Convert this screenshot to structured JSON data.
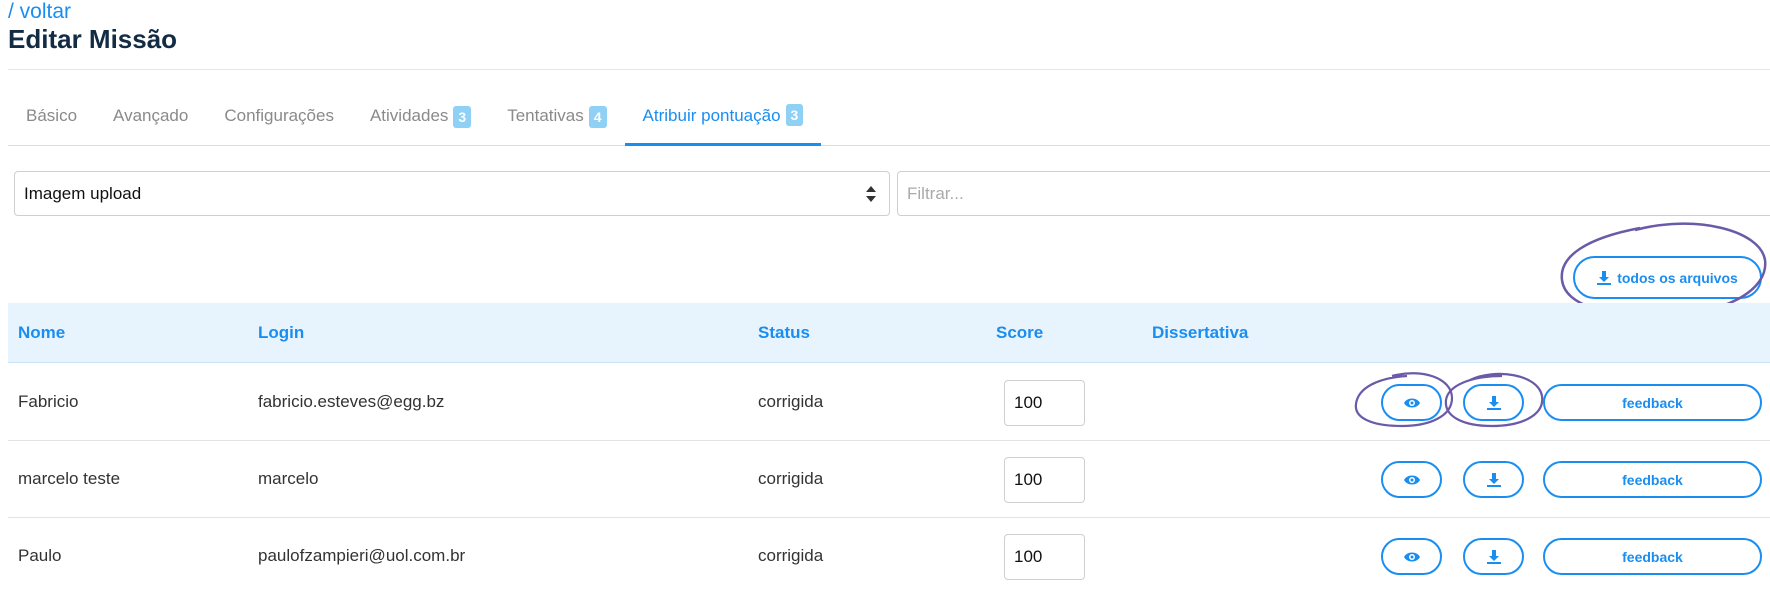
{
  "header": {
    "back_label": "/ voltar",
    "title": "Editar Missão"
  },
  "tabs": [
    {
      "label": "Básico",
      "badge": null
    },
    {
      "label": "Avançado",
      "badge": null
    },
    {
      "label": "Configurações",
      "badge": null
    },
    {
      "label": "Atividades",
      "badge": "3"
    },
    {
      "label": "Tentativas",
      "badge": "4"
    },
    {
      "label": "Atribuir pontuação",
      "badge": "3",
      "active": true
    }
  ],
  "toolbar": {
    "select_value": "Imagem upload",
    "filter_placeholder": "Filtrar...",
    "all_files_label": "todos os arquivos"
  },
  "table": {
    "headers": {
      "name": "Nome",
      "login": "Login",
      "status": "Status",
      "score": "Score",
      "essay": "Dissertativa"
    },
    "rows": [
      {
        "name": "Fabricio",
        "login": "fabricio.esteves@egg.bz",
        "status": "corrigida",
        "score": "100",
        "feedback_label": "feedback"
      },
      {
        "name": "marcelo teste",
        "login": "marcelo",
        "status": "corrigida",
        "score": "100",
        "feedback_label": "feedback"
      },
      {
        "name": "Paulo",
        "login": "paulofzampieri@uol.com.br",
        "status": "corrigida",
        "score": "100",
        "feedback_label": "feedback"
      }
    ]
  },
  "colors": {
    "accent": "#1a8ef0",
    "title": "#142b44",
    "badge": "#8fd0f5",
    "header_bg": "#e8f4fd",
    "annotation": "#6a5aa8"
  },
  "icons": {
    "view": "eye-icon",
    "download": "download-icon"
  }
}
